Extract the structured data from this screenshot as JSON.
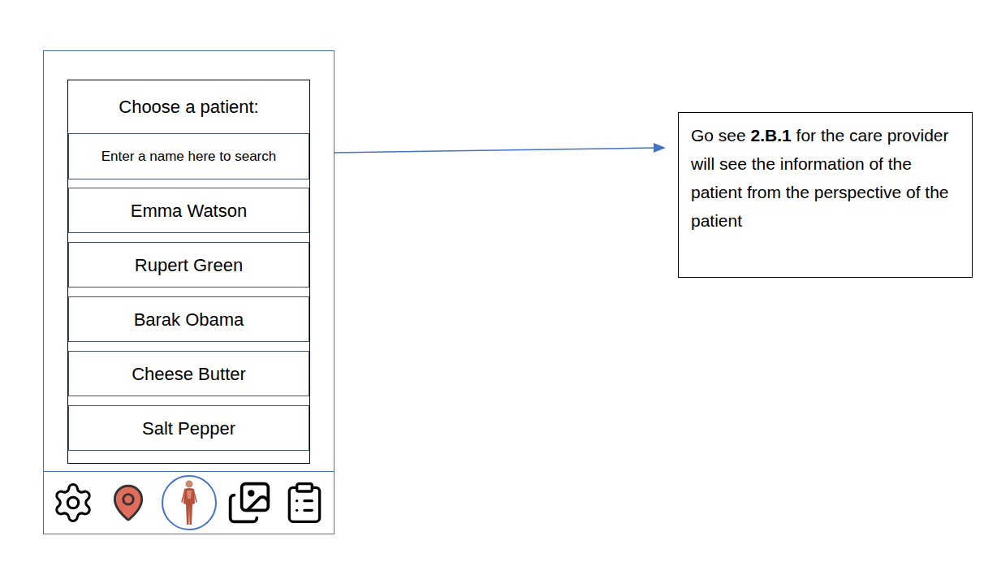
{
  "phone": {
    "list_title": "Choose a patient:",
    "search": {
      "placeholder": "Enter a name here to search"
    },
    "patients": [
      {
        "name": "Emma Watson"
      },
      {
        "name": "Rupert Green"
      },
      {
        "name": "Barak Obama"
      },
      {
        "name": "Cheese Butter"
      },
      {
        "name": "Salt Pepper"
      }
    ],
    "nav": [
      {
        "kind": "settings",
        "selected": false
      },
      {
        "kind": "location",
        "selected": false
      },
      {
        "kind": "body",
        "selected": true
      },
      {
        "kind": "gallery",
        "selected": false
      },
      {
        "kind": "checklist",
        "selected": false
      }
    ]
  },
  "annotation": {
    "prefix": "Go see ",
    "bold": "2.B.1",
    "suffix": " for the care provider will see the information of the patient from the perspective of the patient"
  }
}
